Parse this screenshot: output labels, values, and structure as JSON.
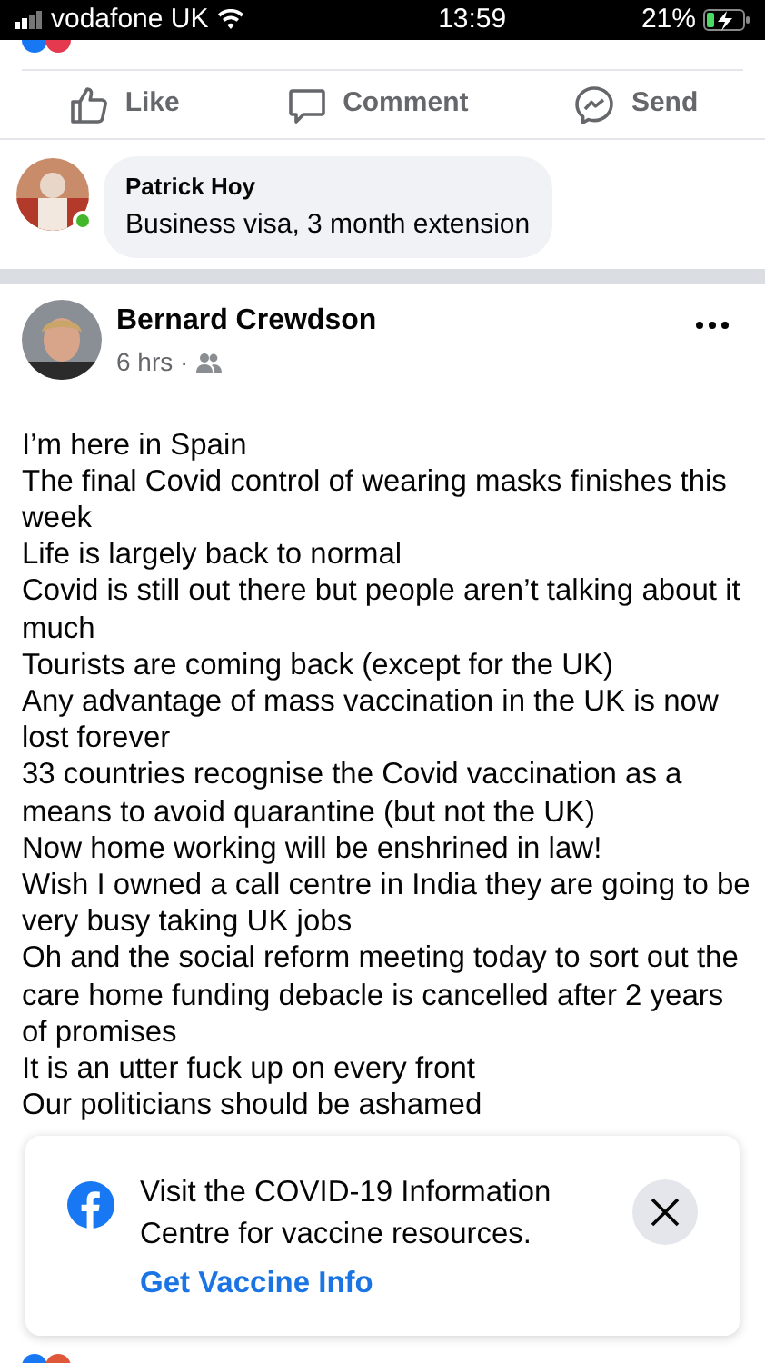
{
  "status_bar": {
    "carrier": "vodafone UK",
    "time": "13:59",
    "battery": "21%"
  },
  "actions": [
    {
      "kind": "like",
      "label": "Like"
    },
    {
      "kind": "comment",
      "label": "Comment"
    },
    {
      "kind": "send",
      "label": "Send"
    }
  ],
  "comment": {
    "author": "Patrick Hoy",
    "text": "Business visa, 3 month extension",
    "online": true
  },
  "post": {
    "author": "Bernard Crewdson",
    "time": "6 hrs ·",
    "lines": [
      "I’m here in Spain",
      "The final Covid control of wearing masks finishes this week",
      "Life is largely back to normal",
      "Covid is still out there but people aren’t talking about it much",
      "Tourists are coming back (except for the UK)",
      "Any advantage of mass vaccination in the UK is now lost forever",
      "33 countries recognise the Covid vaccination as a means to avoid quarantine (but not the UK)",
      "Now home working will be enshrined in law!",
      "Wish I owned a call centre in India they are going to be very busy taking UK jobs",
      "Oh and the social reform meeting today to sort out the care home funding debacle is cancelled after 2 years of promises",
      "It is an utter fuck up on every front",
      "Our politicians should be ashamed"
    ]
  },
  "banner": {
    "text": "Visit the COVID-19 Information Centre for vaccine resources.",
    "link": "Get Vaccine Info"
  }
}
